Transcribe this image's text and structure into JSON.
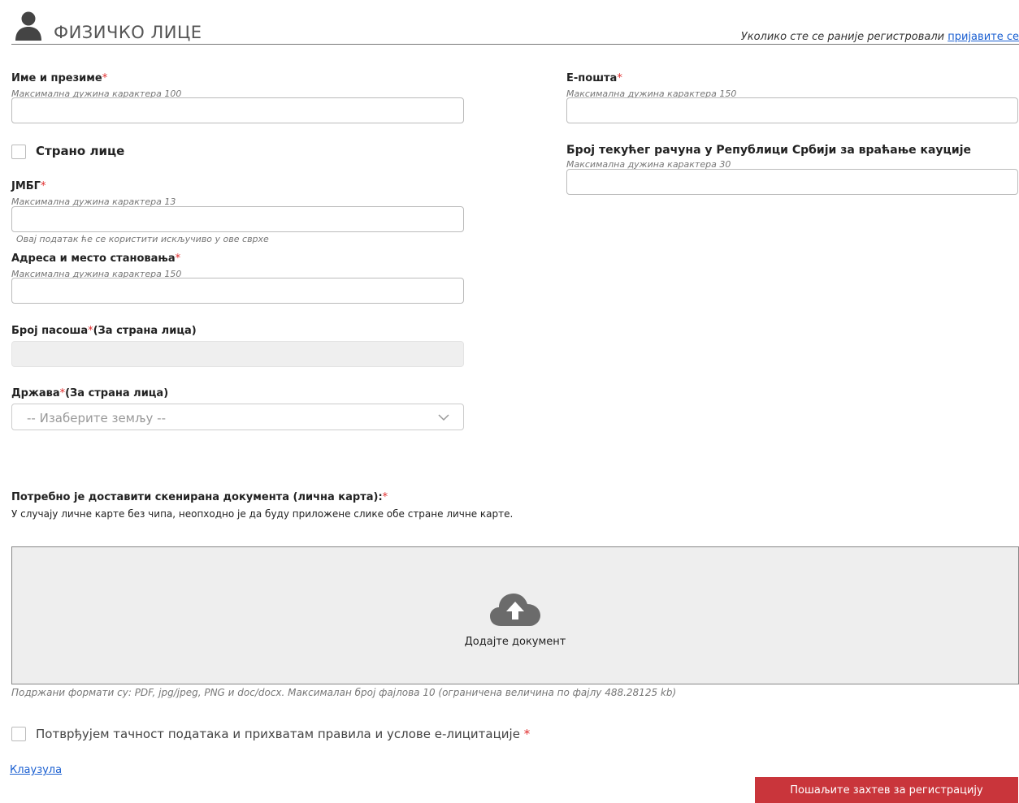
{
  "header": {
    "title": "ФИЗИЧКО ЛИЦЕ",
    "login_hint": "Уколико сте се раније регистровали",
    "login_link": "пријавите се"
  },
  "form": {
    "full_name": {
      "label": "Име и презиме",
      "hint": "Максимална дужина карактера 100",
      "value": ""
    },
    "foreign_person": {
      "label": "Страно лице",
      "checked": false
    },
    "jmbg": {
      "label": "ЈМБГ",
      "hint": "Максимална дужина карактера 13",
      "note": "Овај податак ће се користити искључиво у ове сврхе",
      "value": ""
    },
    "address": {
      "label": "Адреса и место становања",
      "hint": "Максимална дужина карактера 150",
      "value": ""
    },
    "passport": {
      "label": "Број пасоша",
      "suffix": "(За страна лица)",
      "value": ""
    },
    "country": {
      "label": "Држава",
      "suffix": "(За страна лица)",
      "selected": "-- Изаберите земљу --"
    },
    "email": {
      "label": "Е-пошта",
      "hint": "Максимална дужина карактера 150",
      "value": ""
    },
    "bank_account": {
      "label": "Број текућег рачуна у Републици Србији за враћање кауције",
      "hint": "Максимална дужина карактера 30",
      "value": ""
    },
    "required_mark": "*"
  },
  "documents": {
    "title": "Потребно је доставити скенирана документа (лична карта):",
    "description": "У случају личне карте без чипа, неопходно је да буду приложене слике обе стране личне карте.",
    "upload_label": "Додајте документ",
    "formats_note": "Подржани формати су: PDF, jpg/jpeg, PNG и doc/docx. Максималан број фајлова 10 (ограничена величина по фајлу 488.28125 kb)"
  },
  "terms": {
    "label": "Потврђујем тачност података и прихватам правила и услове е-лицитације",
    "checked": false
  },
  "clause_link": "Клаузула",
  "submit_label": "Пошаљите захтев за регистрацију",
  "colors": {
    "accent": "#c9353b",
    "link": "#1a5fd1",
    "required": "#e02b2b"
  },
  "icons": [
    "user-icon",
    "chevron-down-icon",
    "cloud-upload-icon"
  ]
}
